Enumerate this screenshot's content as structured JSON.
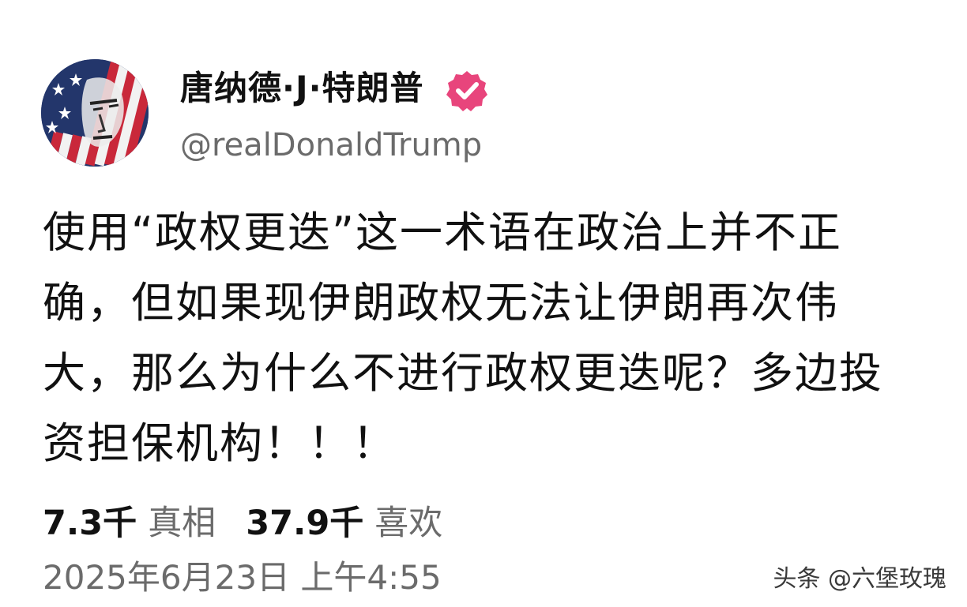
{
  "profile": {
    "display_name": "唐纳德·J·特朗普",
    "handle": "@realDonaldTrump",
    "verified_icon": "verified-badge-icon",
    "verified_color": "#e8457c"
  },
  "post": {
    "lines": [
      "使用“政权更迭”这一术语在政治上并不正",
      "确，但如果现伊朗政权无法让伊朗再次伟",
      "大，那么为什么不进行政权更迭呢？多边投",
      "资担保机构！！！"
    ]
  },
  "stats": {
    "truths_value": "7.3千",
    "truths_label": "真相",
    "likes_value": "37.9千",
    "likes_label": "喜欢"
  },
  "timestamp": "2025年6月23日 上午4:55",
  "watermark": "头条 @六堡玫瑰"
}
